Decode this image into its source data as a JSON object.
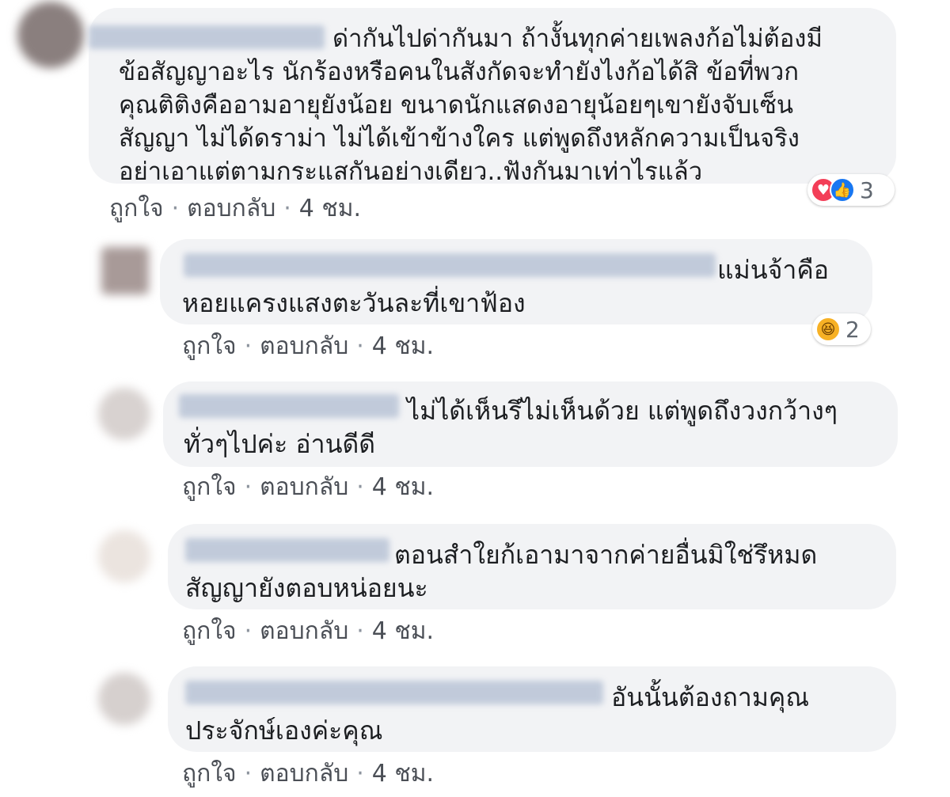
{
  "colors": {
    "bubble_bg": "#f2f3f5",
    "text": "#1c1e21",
    "action_text": "#4b4f56",
    "love_red": "#f33e58",
    "like_blue": "#1877f2",
    "haha_yellow": "#f7b125"
  },
  "actions": {
    "like_label": "ถูกใจ",
    "reply_label": "ตอบกลับ",
    "separator": "·"
  },
  "comments": [
    {
      "text": "ด่ากันไปด่ากันมา ถ้างั้นทุกค่ายเพลงก้อไม่ต้องมี\nข้อสัญญาอะไร นักร้องหรือคนในสังกัดจะทำยังไงก้อได้สิ ข้อที่พวก\nคุณติติงคืออามอายุยังน้อย ขนาดนักแสดงอายุน้อยๆเขายังจับเซ็น\nสัญญา ไม่ได้ดราม่า ไม่ได้เข้าข้างใคร แต่พูดถึงหลักความเป็นจริง\nอย่าเอาแต่ตามกระแสกันอย่างเดียว..ฟังกันมาเท่าไรแล้ว",
      "time": "4 ชม.",
      "reactions": {
        "icons": [
          "love-icon",
          "like-icon"
        ],
        "count": "3"
      }
    },
    {
      "text": "แม่นจ้าคือ\nหอยแครงแสงตะวันละที่เขาฟ้อง",
      "time": "4 ชม.",
      "reactions": {
        "icons": [
          "haha-icon"
        ],
        "count": "2"
      }
    },
    {
      "text": "ไม่ได้เห็นรึไม่เห็นด้วย แต่พูดถึงวงกว้างๆ\nทั่วๆไปค่ะ อ่านดีดี",
      "time": "4 ชม."
    },
    {
      "text": "ตอนสำใยก้เอามาจากค่ายอื่นมิใช่รึหมด\nสัญญายังตอบหน่อยนะ",
      "time": "4 ชม."
    },
    {
      "text": "อันนั้นต้องถามคุณ\nประจักษ์เองค่ะคุณ",
      "time": "4 ชม."
    }
  ]
}
